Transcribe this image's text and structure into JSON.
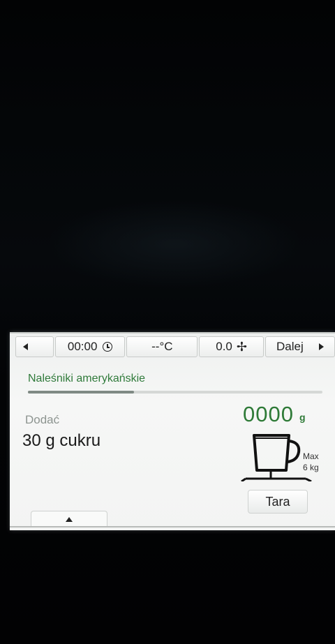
{
  "topbar": {
    "timer": "00:00",
    "temperature": "--°C",
    "speed": "0.0",
    "next_label": "Dalej"
  },
  "recipe": {
    "title": "Naleśniki amerykańskie",
    "progress_fraction": 0.36
  },
  "step": {
    "label": "Dodać",
    "instruction": "30 g cukru"
  },
  "scale": {
    "weight": "0000",
    "unit": "g",
    "max_label": "Max",
    "max_value": "6 kg"
  },
  "buttons": {
    "tara": "Tara"
  },
  "colors": {
    "accent_green": "#2e7a37",
    "screen_bg": "#f3f4f3"
  }
}
